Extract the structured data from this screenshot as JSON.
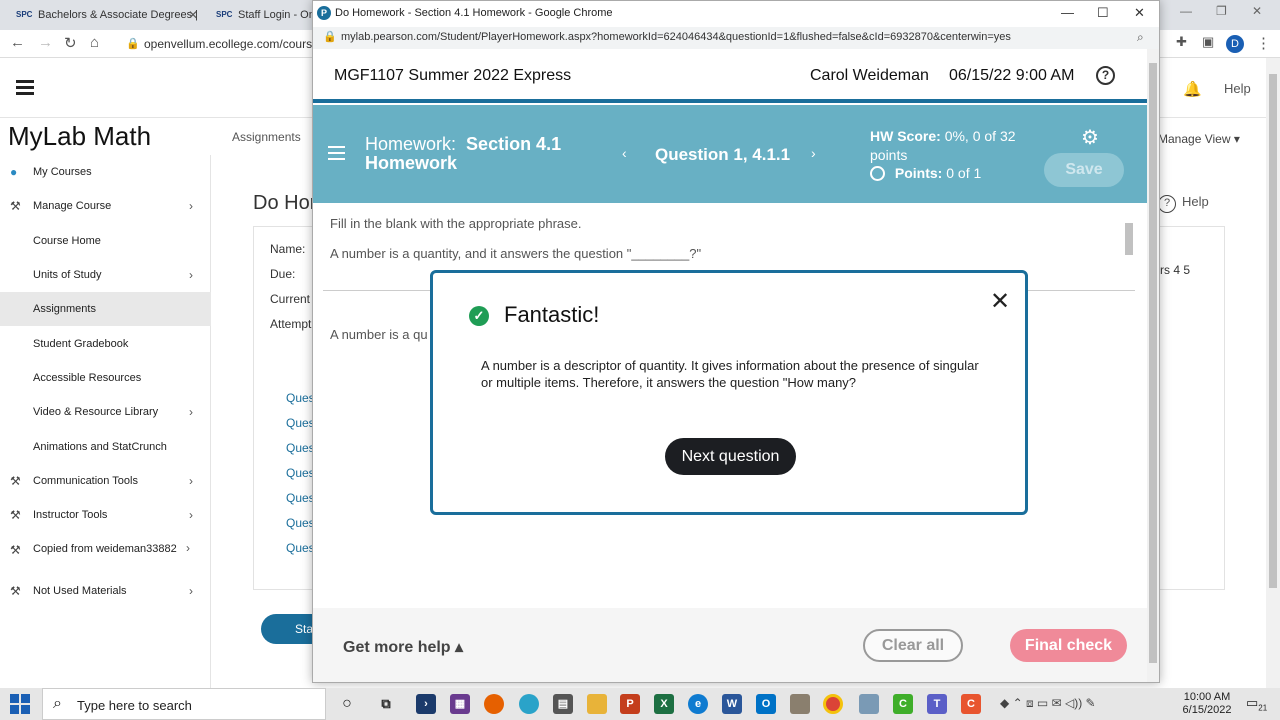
{
  "bg_browser": {
    "tabs": [
      {
        "favicon": "SPC",
        "label": "Bachelors & Associate Degrees |"
      },
      {
        "favicon": "SPC",
        "label": "Staff Login - One"
      }
    ],
    "url": "openvellum.ecollege.com/course"
  },
  "app": {
    "brand": "MyLab Math",
    "help": "Help",
    "assignments_tab": "Assignments",
    "manage_view": "Manage View ▾",
    "page_title": "Do Hor",
    "page_help": "Help",
    "fields": [
      "Name:",
      "Due:",
      "Current",
      "Attempt"
    ],
    "question_links": [
      "Ques",
      "Ques",
      "Ques",
      "Ques",
      "Ques",
      "Ques",
      "Ques"
    ],
    "chapters": "rs 4 5",
    "start_button": "Sta"
  },
  "sidebar": {
    "items": [
      {
        "label": "My Courses",
        "icon": "back-circle-icon"
      },
      {
        "label": "Manage Course",
        "icon": "tools-icon"
      },
      {
        "label": "Course Home"
      },
      {
        "label": "Units of Study"
      },
      {
        "label": "Assignments"
      },
      {
        "label": "Student Gradebook"
      },
      {
        "label": "Accessible Resources"
      },
      {
        "label": "Video & Resource Library"
      },
      {
        "label": "Animations and StatCrunch"
      },
      {
        "label": "Communication Tools",
        "icon": "tools-icon"
      },
      {
        "label": "Instructor Tools",
        "icon": "tools-icon"
      },
      {
        "label": "Copied from weideman33882",
        "icon": "tools-icon"
      },
      {
        "label": "Not Used Materials",
        "icon": "tools-icon"
      }
    ]
  },
  "popup": {
    "window_title": "Do Homework - Section 4.1 Homework - Google Chrome",
    "url": "mylab.pearson.com/Student/PlayerHomework.aspx?homeworkId=624046434&questionId=1&flushed=false&cId=6932870&centerwin=yes",
    "course": "MGF1107 Summer 2022 Express",
    "student": "Carol Weideman",
    "datetime": "06/15/22 9:00 AM",
    "help_glyph": "?",
    "hw_prefix": "Homework:",
    "hw_name": "Section 4.1 Homework",
    "question": "Question 1, 4.1.1",
    "score_label": "HW Score:",
    "score_value": "0%, 0 of 32 points",
    "points_label": "Points:",
    "points_value": "0 of 1",
    "save": "Save",
    "instruction": "Fill in the blank with the appropriate phrase.",
    "question_text": "A number is a quantity, and it answers the question \"________?\"",
    "answer_partial": "A number is a qu",
    "more_help": "Get more help ▴",
    "clear_all": "Clear all",
    "final_check": "Final check"
  },
  "modal": {
    "title": "Fantastic!",
    "body": "A number is a descriptor of quantity. It gives information about the presence of singular or multiple items. Therefore, it answers the question \"How many?",
    "next": "Next question"
  },
  "taskbar": {
    "search_placeholder": "Type here to search",
    "time": "10:00 AM",
    "date": "6/15/2022",
    "notifications": "21"
  },
  "colors": {
    "accent": "#1a6e9b",
    "header_teal": "#68b0c4",
    "final_check": "#f08a99",
    "success": "#1f9d55"
  }
}
